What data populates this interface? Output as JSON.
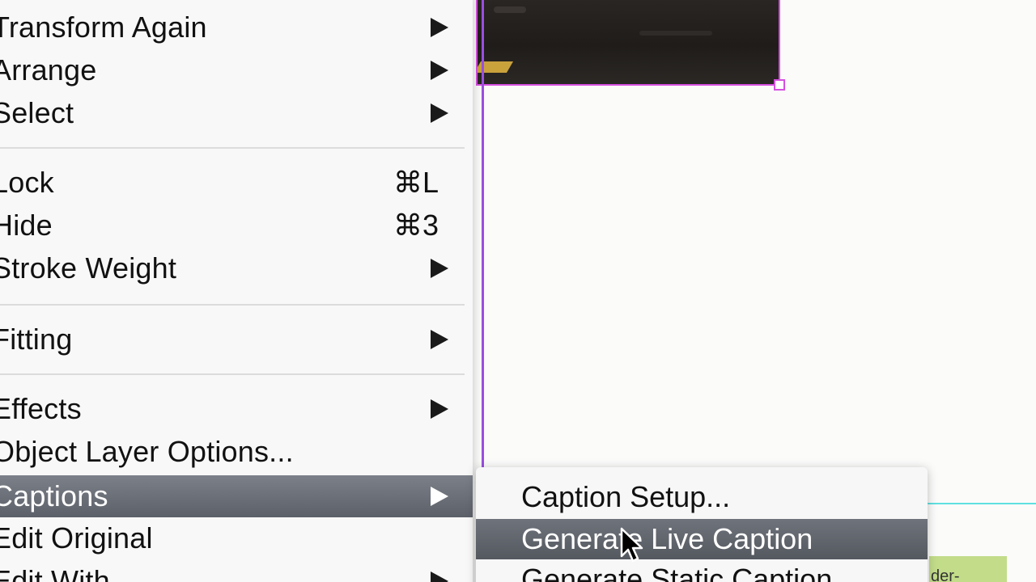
{
  "main_menu": {
    "items": [
      {
        "label": "Transform Again",
        "shortcut": "",
        "submenu": true
      },
      {
        "label": "Arrange",
        "shortcut": "",
        "submenu": true
      },
      {
        "label": "Select",
        "shortcut": "",
        "submenu": true
      },
      {
        "label": "Lock",
        "shortcut": "⌘L",
        "submenu": false
      },
      {
        "label": "Hide",
        "shortcut": "⌘3",
        "submenu": false
      },
      {
        "label": "Stroke Weight",
        "shortcut": "",
        "submenu": true
      },
      {
        "label": "Fitting",
        "shortcut": "",
        "submenu": true
      },
      {
        "label": "Effects",
        "shortcut": "",
        "submenu": true
      },
      {
        "label": "Object Layer Options...",
        "shortcut": "",
        "submenu": false
      },
      {
        "label": "Captions",
        "shortcut": "",
        "submenu": true,
        "highlighted": true
      },
      {
        "label": "Edit Original",
        "shortcut": "",
        "submenu": false
      },
      {
        "label": "Edit With",
        "shortcut": "",
        "submenu": true
      }
    ]
  },
  "captions_submenu": {
    "items": [
      {
        "label": "Caption Setup..."
      },
      {
        "label": "Generate Live Caption",
        "highlighted": true
      },
      {
        "label": "Generate Static Caption"
      }
    ]
  },
  "canvas": {
    "fragment_text": "der-"
  },
  "colors": {
    "frame_selection": "#d64fe0",
    "guide": "#9a4fe0",
    "highlight": "#6f737b"
  }
}
